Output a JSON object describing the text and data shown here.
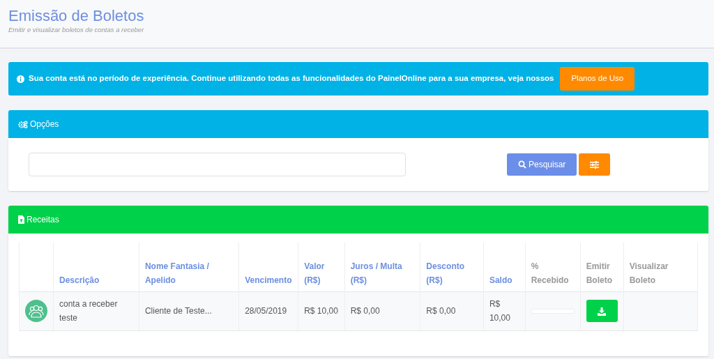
{
  "header": {
    "title": "Emissão de Boletos",
    "subtitle": "Emitir e visualizar boletos de contas a receber"
  },
  "alert": {
    "text": "Sua conta está no período de experiência. Continue utilizando todas as funcionalidades do PainelOnline para a sua empresa, veja nossos",
    "button": "Planos de Uso"
  },
  "options": {
    "title": "Opções",
    "search_button": "Pesquisar"
  },
  "table": {
    "title": "Receitas",
    "columns": [
      {
        "label": "Descrição",
        "sortable": true
      },
      {
        "label": "Nome Fantasia / Apelido",
        "sortable": true
      },
      {
        "label": "Vencimento",
        "sortable": true
      },
      {
        "label": "Valor (R$)",
        "sortable": true
      },
      {
        "label": "Juros / Multa (R$)",
        "sortable": true
      },
      {
        "label": "Desconto (R$)",
        "sortable": true
      },
      {
        "label": "Saldo",
        "sortable": true
      },
      {
        "label": "% Recebido",
        "sortable": false
      },
      {
        "label": "Emitir Boleto",
        "sortable": false
      },
      {
        "label": "Visualizar Boleto",
        "sortable": false
      }
    ],
    "rows": [
      {
        "description": "conta a receber teste",
        "name": "Cliente de Teste...",
        "due": "28/05/2019",
        "value": "R$ 10,00",
        "interest": "R$ 0,00",
        "discount": "R$ 0,00",
        "balance": "R$ 10,00",
        "received": {
          "level": 0
        }
      }
    ]
  }
}
